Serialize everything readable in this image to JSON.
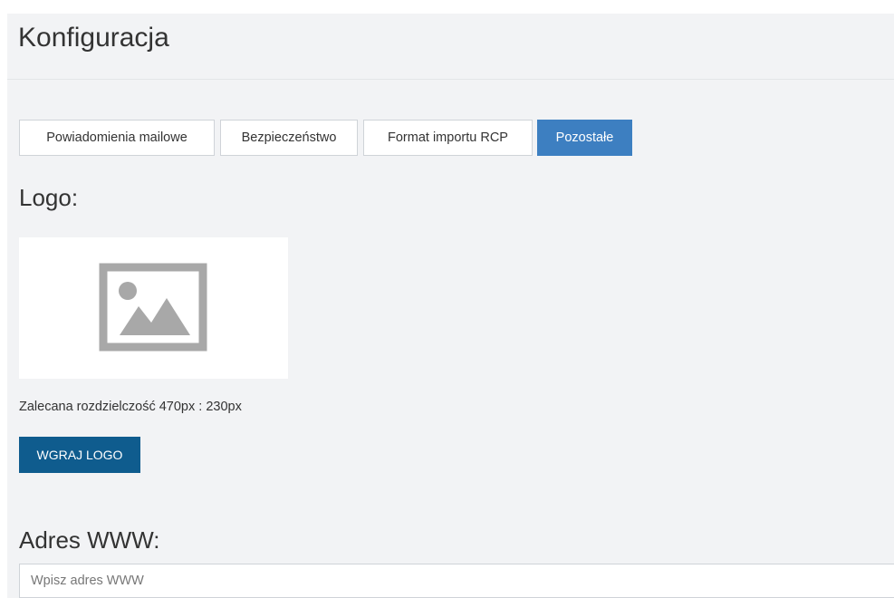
{
  "page": {
    "title": "Konfiguracja"
  },
  "tabs": [
    {
      "label": "Powiadomienia mailowe",
      "active": false
    },
    {
      "label": "Bezpieczeństwo",
      "active": false
    },
    {
      "label": "Format importu RCP",
      "active": false
    },
    {
      "label": "Pozostałe",
      "active": true
    }
  ],
  "logo": {
    "label": "Logo:",
    "placeholder_icon": "image-placeholder-icon",
    "resolution_note": "Zalecana rozdzielczość 470px : 230px",
    "upload_button": "WGRAJ LOGO"
  },
  "website": {
    "label": "Adres WWW:",
    "value": "",
    "placeholder": "Wpisz adres WWW"
  },
  "colors": {
    "active_tab": "#3d7fc1",
    "upload_button": "#0f5c8e",
    "page_background": "#f2f3f5"
  }
}
